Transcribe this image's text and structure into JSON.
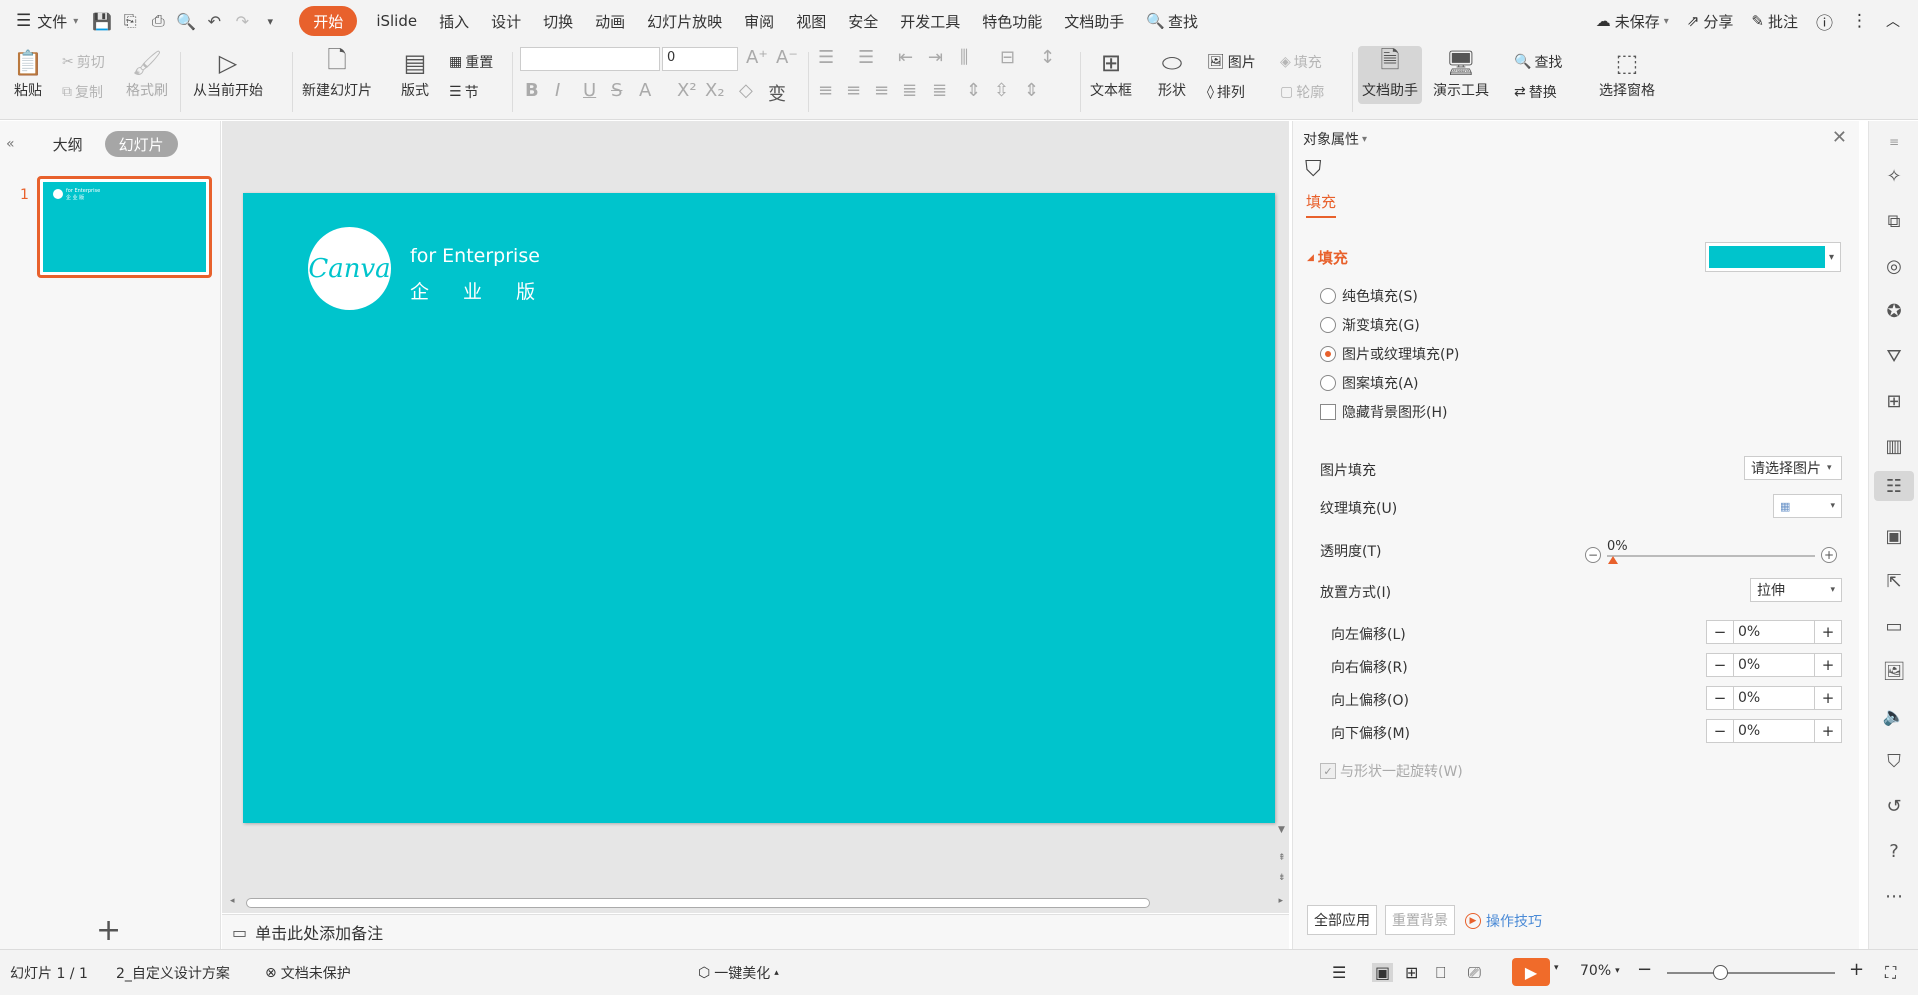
{
  "menubar": {
    "file_label": "文件",
    "tabs": [
      "开始",
      "iSlide",
      "插入",
      "设计",
      "切换",
      "动画",
      "幻灯片放映",
      "审阅",
      "视图",
      "安全",
      "开发工具",
      "特色功能",
      "文档助手"
    ],
    "search_label": "查找",
    "unsaved_label": "未保存",
    "share_label": "分享",
    "comment_label": "批注"
  },
  "ribbon": {
    "paste": "粘贴",
    "cut": "剪切",
    "copy": "复制",
    "format_painter": "格式刷",
    "from_current": "从当前开始",
    "new_slide": "新建幻灯片",
    "layout": "版式",
    "reset": "重置",
    "section": "节",
    "font_size_value": "0",
    "textbox": "文本框",
    "shape": "形状",
    "picture": "图片",
    "fill": "填充",
    "arrange": "排列",
    "outline": "轮廓",
    "doc_assistant": "文档助手",
    "present_tools": "演示工具",
    "find": "查找",
    "replace": "替换",
    "select_pane": "选择窗格"
  },
  "left_panel": {
    "tab_outline": "大纲",
    "tab_slides": "幻灯片",
    "slide_number": "1"
  },
  "slide": {
    "logo_text": "Canva",
    "brand_line1": "for Enterprise",
    "brand_line2": "企 业 版",
    "background_color": "#00c4cc"
  },
  "notes_placeholder": "单击此处添加备注",
  "right_panel": {
    "title": "对象属性",
    "tab_fill": "填充",
    "section_fill": "填充",
    "fill_color": "#00c4cc",
    "options": [
      {
        "label": "纯色填充(S)",
        "selected": false
      },
      {
        "label": "渐变填充(G)",
        "selected": false
      },
      {
        "label": "图片或纹理填充(P)",
        "selected": true
      },
      {
        "label": "图案填充(A)",
        "selected": false
      }
    ],
    "hide_bg_shapes": "隐藏背景图形(H)",
    "picture_fill_label": "图片填充",
    "picture_fill_value": "请选择图片",
    "texture_fill_label": "纹理填充(U)",
    "transparency_label": "透明度(T)",
    "transparency_value": "0%",
    "placement_label": "放置方式(I)",
    "placement_value": "拉伸",
    "offsets": [
      {
        "label": "向左偏移(L)",
        "value": "0%"
      },
      {
        "label": "向右偏移(R)",
        "value": "0%"
      },
      {
        "label": "向上偏移(O)",
        "value": "0%"
      },
      {
        "label": "向下偏移(M)",
        "value": "0%"
      }
    ],
    "rotate_with_shape": "与形状一起旋转(W)",
    "apply_all": "全部应用",
    "reset_bg": "重置背景",
    "tips": "操作技巧"
  },
  "statusbar": {
    "slide_info": "幻灯片 1 / 1",
    "theme": "2_自定义设计方案",
    "protection": "文档未保护",
    "beautify": "一键美化",
    "zoom": "70%"
  }
}
